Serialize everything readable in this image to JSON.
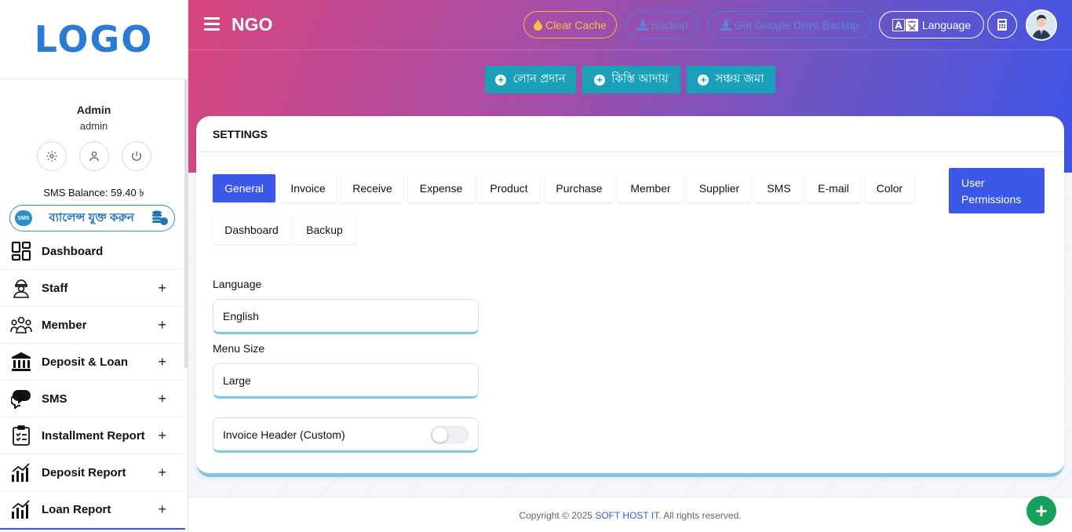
{
  "sidebar": {
    "logo": "LOGO",
    "profile": {
      "name": "Admin",
      "role": "admin"
    },
    "sms_balance": "SMS Balance: 59.40 ৳",
    "sms_add_label": "ব্যালেন্স যুক্ত করুন",
    "sms_logo_text": "SMS",
    "menu": [
      {
        "label": "Dashboard",
        "icon": "dashboard-icon",
        "expandable": false
      },
      {
        "label": "Staff",
        "icon": "staff-icon",
        "expandable": true
      },
      {
        "label": "Member",
        "icon": "member-icon",
        "expandable": true
      },
      {
        "label": "Deposit & Loan",
        "icon": "bank-icon",
        "expandable": true
      },
      {
        "label": "SMS",
        "icon": "chat-icon",
        "expandable": true
      },
      {
        "label": "Installment Report",
        "icon": "clipboard-icon",
        "expandable": true
      },
      {
        "label": "Deposit Report",
        "icon": "chart-icon",
        "expandable": true
      },
      {
        "label": "Loan Report",
        "icon": "chart-icon",
        "expandable": true
      }
    ]
  },
  "header": {
    "title": "NGO",
    "clear_cache": "Clear Cache",
    "backup": "Backup",
    "gdrive_backup": "Get Google Drive Backup",
    "language": "Language"
  },
  "quick_actions": {
    "loan": "লোন প্রদান",
    "installment": "কিস্তি আদায়",
    "savings": "সঞ্চয় জমা"
  },
  "settings": {
    "title": "SETTINGS",
    "tabs": [
      "General",
      "Invoice",
      "Receive",
      "Expense",
      "Product",
      "Purchase",
      "Member",
      "Supplier",
      "SMS",
      "E-mail",
      "Color",
      "Dashboard",
      "Backup"
    ],
    "active_tab": "General",
    "user_permissions": "User Permissions",
    "language_label": "Language",
    "language_value": "English",
    "menu_size_label": "Menu Size",
    "menu_size_value": "Large",
    "invoice_header_label": "Invoice Header (Custom)",
    "invoice_header_enabled": false
  },
  "footer": {
    "prefix": "Copyright © 2025 ",
    "brand": "SOFT HOST IT",
    "suffix": ". All rights reserved."
  },
  "colors": {
    "primary": "#3a57e8",
    "teal": "#1aa0b8",
    "success": "#16a05d",
    "accent_border": "#7fc9dd"
  }
}
